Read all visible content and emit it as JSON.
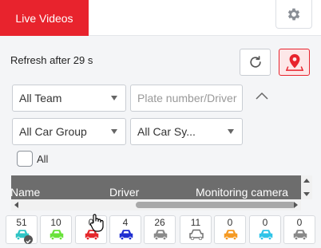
{
  "header": {
    "tab_live_videos": "Live Videos",
    "settings_icon": "gear-icon"
  },
  "refresh": {
    "text": "Refresh after 29 s",
    "refresh_icon": "refresh-icon",
    "location_icon": "map-pin-icon"
  },
  "filters": {
    "team": "All Team",
    "plate_placeholder": "Plate number/Driver",
    "car_group": "All Car Group",
    "car_system": "All Car Sy...",
    "all_label": "All",
    "collapse_icon": "chevron-up-icon"
  },
  "table": {
    "columns": [
      "Name",
      "Driver",
      "Monitoring camera"
    ]
  },
  "status_counts": [
    {
      "count": "51",
      "color": "#2ec4c4",
      "icon": "car-icon"
    },
    {
      "count": "10",
      "color": "#69e23a",
      "icon": "car-icon"
    },
    {
      "count": "0",
      "color": "#e5262b",
      "icon": "car-icon"
    },
    {
      "count": "4",
      "color": "#1f2fd1",
      "icon": "car-icon"
    },
    {
      "count": "26",
      "color": "#8a8a8a",
      "icon": "car-icon"
    },
    {
      "count": "11",
      "color": "#6e6e6e",
      "icon": "car-outline-icon"
    },
    {
      "count": "0",
      "color": "#f59a23",
      "icon": "car-icon"
    },
    {
      "count": "0",
      "color": "#2ec4e8",
      "icon": "car-icon"
    },
    {
      "count": "0",
      "color": "#888888",
      "icon": "car-icon"
    }
  ],
  "colors": {
    "accent": "#e8232d",
    "table_header": "#6d6d6d"
  }
}
